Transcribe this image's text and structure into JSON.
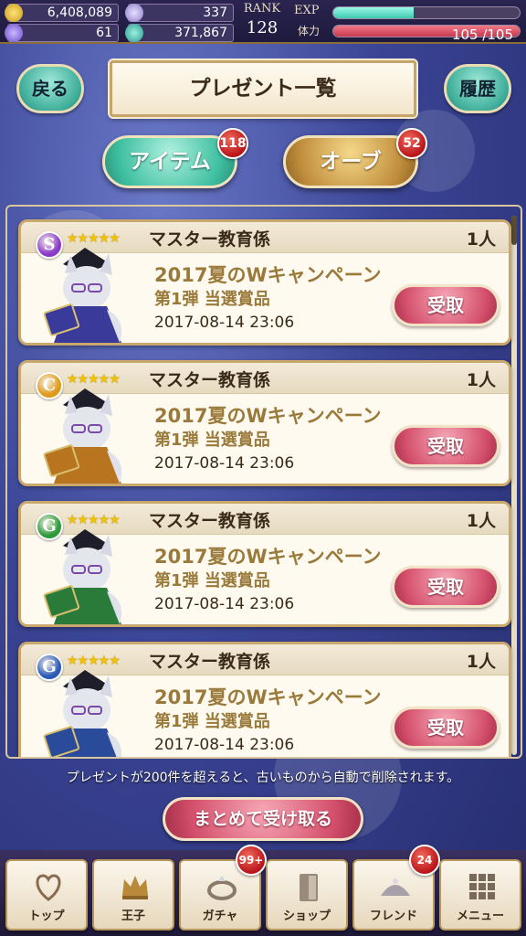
{
  "status": {
    "coins": "6,408,089",
    "crystals": "337",
    "gems": "61",
    "points": "371,867",
    "rank_label": "RANK",
    "rank_value": "128",
    "exp_label": "EXP",
    "exp_fraction": 0.43,
    "stamina_label": "体力",
    "stamina_text": "105 /105",
    "stamina_fraction": 1.0
  },
  "header": {
    "back_label": "戻る",
    "title": "プレゼント一覧",
    "history_label": "履歴"
  },
  "tabs": [
    {
      "label": "アイテム",
      "badge": "118"
    },
    {
      "label": "オーブ",
      "badge": "52"
    }
  ],
  "items": [
    {
      "orb_letter": "S",
      "orb_color": "#8a3ac8",
      "name": "マスター教育係",
      "count": "1人",
      "desc1": "2017夏のWキャンペーン",
      "desc2": "第1弾 当選賞品",
      "date": "2017-08-14 23:06",
      "button": "受取",
      "stars": "★★★★★",
      "robe_color": "#3a3a9a"
    },
    {
      "orb_letter": "C",
      "orb_color": "#e09a1a",
      "name": "マスター教育係",
      "count": "1人",
      "desc1": "2017夏のWキャンペーン",
      "desc2": "第1弾 当選賞品",
      "date": "2017-08-14 23:06",
      "button": "受取",
      "stars": "★★★★★",
      "robe_color": "#b8741e"
    },
    {
      "orb_letter": "G",
      "orb_color": "#2e9a3a",
      "name": "マスター教育係",
      "count": "1人",
      "desc1": "2017夏のWキャンペーン",
      "desc2": "第1弾 当選賞品",
      "date": "2017-08-14 23:06",
      "button": "受取",
      "stars": "★★★★★",
      "robe_color": "#2a7a3a"
    },
    {
      "orb_letter": "G",
      "orb_color": "#2a5ab8",
      "name": "マスター教育係",
      "count": "1人",
      "desc1": "2017夏のWキャンペーン",
      "desc2": "第1弾 当選賞品",
      "date": "2017-08-14 23:06",
      "button": "受取",
      "stars": "★★★★★",
      "robe_color": "#2a4a9a"
    }
  ],
  "notice": "プレゼントが200件を超えると、古いものから自動で削除されます。",
  "bulk_button": "まとめて受け取る",
  "nav": [
    {
      "label": "トップ",
      "icon": "heart-emblem-icon"
    },
    {
      "label": "王子",
      "icon": "crown-icon"
    },
    {
      "label": "ガチャ",
      "icon": "ring-icon",
      "badge": "99+"
    },
    {
      "label": "ショップ",
      "icon": "door-icon"
    },
    {
      "label": "フレンド",
      "icon": "tiara-icon",
      "badge": "24"
    },
    {
      "label": "メニュー",
      "icon": "grid-menu-icon"
    }
  ]
}
